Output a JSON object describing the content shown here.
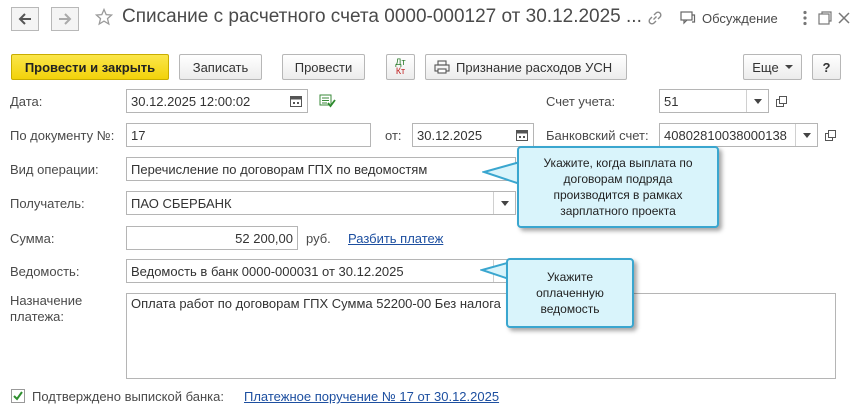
{
  "header": {
    "title": "Списание с расчетного счета 0000-000127 от 30.12.2025 ...",
    "discussion_label": "Обсуждение"
  },
  "toolbar": {
    "post_close_label": "Провести и закрыть",
    "save_label": "Записать",
    "post_label": "Провести",
    "dt_kt_top": "Дт",
    "dt_kt_bottom": "Кт",
    "usn_label": "Признание расходов УСН",
    "more_label": "Еще",
    "help_label": "?"
  },
  "form": {
    "date_label": "Дата:",
    "date_value": "30.12.2025 12:00:02",
    "account_label": "Счет учета:",
    "account_value": "51",
    "doc_num_label": "По документу №:",
    "doc_num_value": "17",
    "from_label": "от:",
    "from_value": "30.12.2025",
    "bank_account_label": "Банковский счет:",
    "bank_account_value": "40802810038000138",
    "op_type_label": "Вид операции:",
    "op_type_value": "Перечисление по договорам ГПХ по ведомостям",
    "recipient_label": "Получатель:",
    "recipient_value": "ПАО СБЕРБАНК",
    "amount_label": "Сумма:",
    "amount_value": "52 200,00",
    "currency_label": "руб.",
    "split_link": "Разбить платеж",
    "statement_label": "Ведомость:",
    "statement_value": "Ведомость в банк 0000-000031 от 30.12.2025",
    "purpose_label_1": "Назначение",
    "purpose_label_2": "платежа:",
    "purpose_value": "Оплата работ по договорам ГПХ Сумма 52200-00 Без налога",
    "confirmed_label": "Подтверждено выпиской банка:",
    "payment_order_link": "Платежное поручение № 17 от 30.12.2025"
  },
  "tooltips": {
    "tip1_line1": "Укажите, когда выплата по",
    "tip1_line2": "договорам подряда",
    "tip1_line3": "производится в рамках",
    "tip1_line4": "зарплатного проекта",
    "tip2_line1": "Укажите",
    "tip2_line2": "оплаченную",
    "tip2_line3": "ведомость"
  },
  "colors": {
    "primary_button": "#f2d20a",
    "link": "#1d4fa0",
    "tooltip_bg": "#d9f4fb",
    "tooltip_border": "#3aa6cf",
    "checkbox_mark": "#2f8f2f"
  }
}
